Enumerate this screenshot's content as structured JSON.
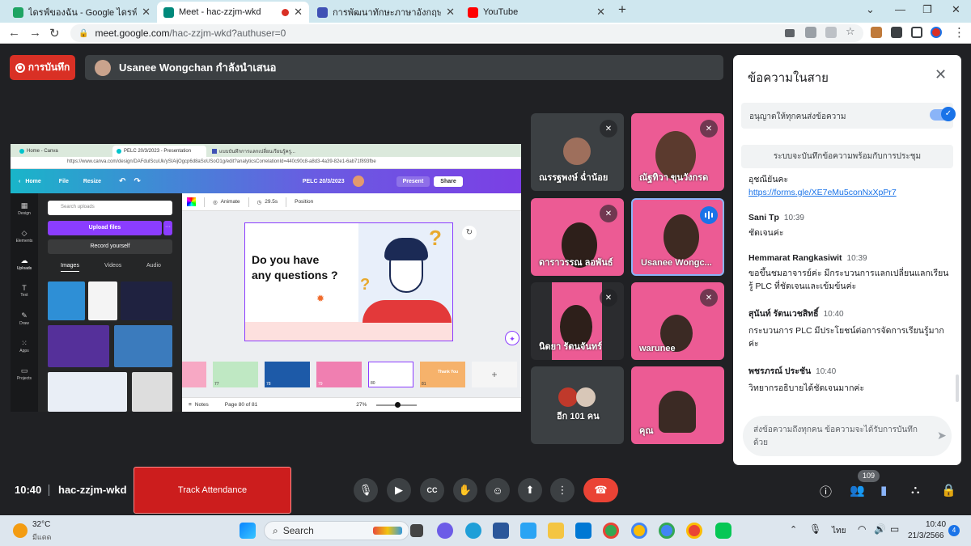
{
  "browser": {
    "tabs": [
      {
        "title": "ไดรฟ์ของฉัน - Google ไดรฟ์",
        "color": "#1fa463"
      },
      {
        "title": "Meet - hac-zzjm-wkd",
        "color": "#00897b"
      },
      {
        "title": "การพัฒนาทักษะภาษาอังกฤษ English",
        "color": "#3f51b5"
      },
      {
        "title": "YouTube",
        "color": "#ff0000"
      }
    ],
    "url_host": "meet.google.com",
    "url_path": "/hac-zzjm-wkd?authuser=0"
  },
  "meet": {
    "record_label": "การบันทึก",
    "presenting_text": "Usanee Wongchan กำลังนำเสนอ",
    "time": "10:40",
    "code": "hac-zzjm-wkd",
    "track_attendance": "Track Attendance",
    "participants_count": "109"
  },
  "shared": {
    "tabs": [
      "Home - Canva",
      "PELC 20/3/2023 - Presentation",
      "แบบบันทึกการแลกเปลี่ยนเรียนรู้ครู..."
    ],
    "url": "https://www.canva.com/design/DAFdulScuUk/ySIAijOgcp6d8aSoUSoO1g/edit?analyticsCorrelationId=440c90c8-a8d3-4a39-82e1-6ab71f893fbe",
    "canva_home": "Home",
    "canva_file": "File",
    "canva_resize": "Resize",
    "doc_title": "PELC 20/3/2023",
    "present": "Present",
    "share": "Share",
    "side_items": [
      "Design",
      "Elements",
      "Uploads",
      "Text",
      "Draw",
      "Apps",
      "Projects"
    ],
    "search_placeholder": "Search uploads",
    "upload_files": "Upload files",
    "record_yourself": "Record yourself",
    "panel_tabs": [
      "Images",
      "Videos",
      "Audio"
    ],
    "animate": "Animate",
    "duration": "29.5s",
    "position": "Position",
    "slide_question": "Do you have\nany questions ?",
    "notes": "Notes",
    "page_info": "Page 80 of 81",
    "zoom": "27%",
    "strip_numbers": [
      "77",
      "78",
      "79",
      "80",
      "81"
    ],
    "thank_you": "Thank You"
  },
  "tiles": [
    {
      "name": "ณรรฐพงษ์ ฉ่ำน้อย"
    },
    {
      "name": "ณัฐทิวา ขุนวังกรด"
    },
    {
      "name": "ดาราวรรณ ลอพันธ์"
    },
    {
      "name": "Usanee Wongc..."
    },
    {
      "name": "นิดยา รัตนจันทร์"
    },
    {
      "name": "warunee"
    },
    {
      "name": "อีก 101 คน"
    },
    {
      "name": "คุณ"
    }
  ],
  "chat": {
    "title": "ข้อความในสาย",
    "allow": "อนุญาตให้ทุกคนส่งข้อความ",
    "saved": "ระบบจะบันทึกข้อความพร้อมกับการประชุม",
    "messages": [
      {
        "sender": "",
        "time": "",
        "text": "อุชณียันคะ",
        "link": "https://forms.gle/XE7eMu5conNxXpPr7"
      },
      {
        "sender": "Sani Tp",
        "time": "10:39",
        "text": "ชัดเจนค่ะ"
      },
      {
        "sender": "Hemmarat Rangkasiwit",
        "time": "10:39",
        "text": "ขอขึ้นชมอาจารย์ค่ะ มีกระบวนการแลกเปลี่ยนแลกเรียนรู้ PLC ที่ชัดเจนและเข้มข้นค่ะ"
      },
      {
        "sender": "สุนันท์ รัตนเวชสิทธิ์",
        "time": "10:40",
        "text": "กระบวนการ PLC มีประโยชน์ต่อการจัดการเรียนรู้มากค่ะ"
      },
      {
        "sender": "พชรภรณ์ ประชัน",
        "time": "10:40",
        "text": "วิทยากรอธิบายได้ชัดเจนมากค่ะ"
      }
    ],
    "input_placeholder": "ส่งข้อความถึงทุกคน ข้อความจะได้รับการบันทึกด้วย"
  },
  "taskbar": {
    "temp": "32°C",
    "weather": "มีแดด",
    "search": "Search",
    "lang": "ไทย",
    "time": "10:40",
    "date": "21/3/2566",
    "notif": "4"
  }
}
